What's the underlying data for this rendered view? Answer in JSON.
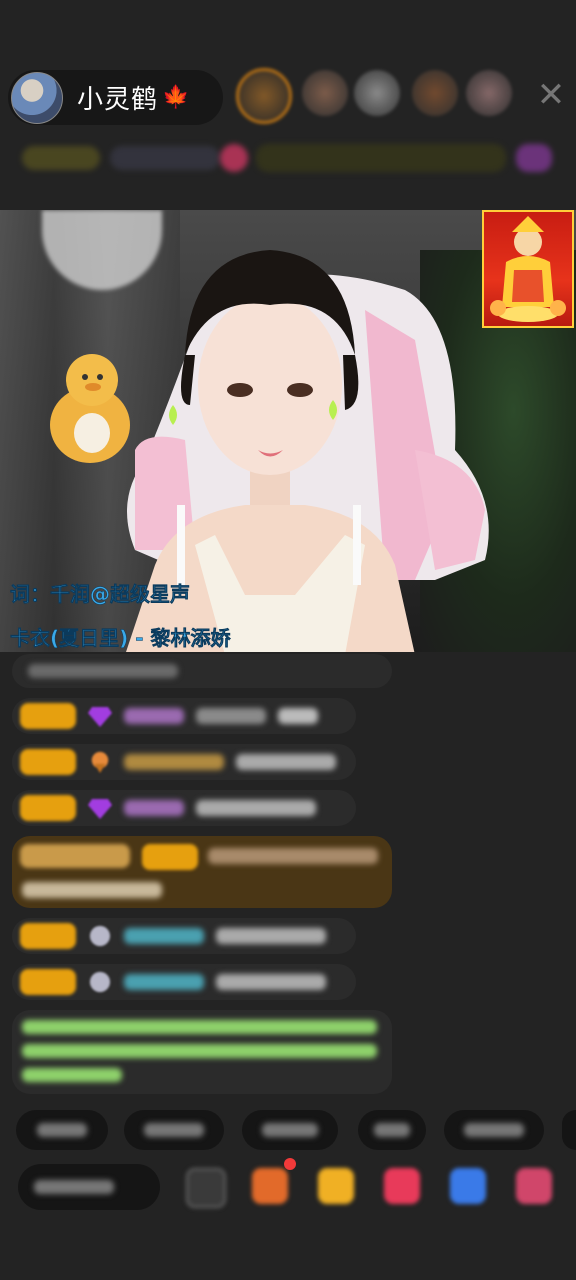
{
  "header": {
    "host_name": "小灵鹤",
    "host_name_icon": "maple-leaf-icon",
    "close_icon": "close-icon"
  },
  "video": {
    "lyric_lines": [
      "词：千润@超级星声",
      "卡衣(夏日里) - 黎林添娇"
    ]
  },
  "colors": {
    "background": "#232323",
    "lyric_text": "#3aa9e8",
    "level_badge": "#e6a00f",
    "gem_purple": "#a23de0",
    "highlight_message_bg": "#4a3615",
    "green_message_text": "#8ed16b"
  }
}
